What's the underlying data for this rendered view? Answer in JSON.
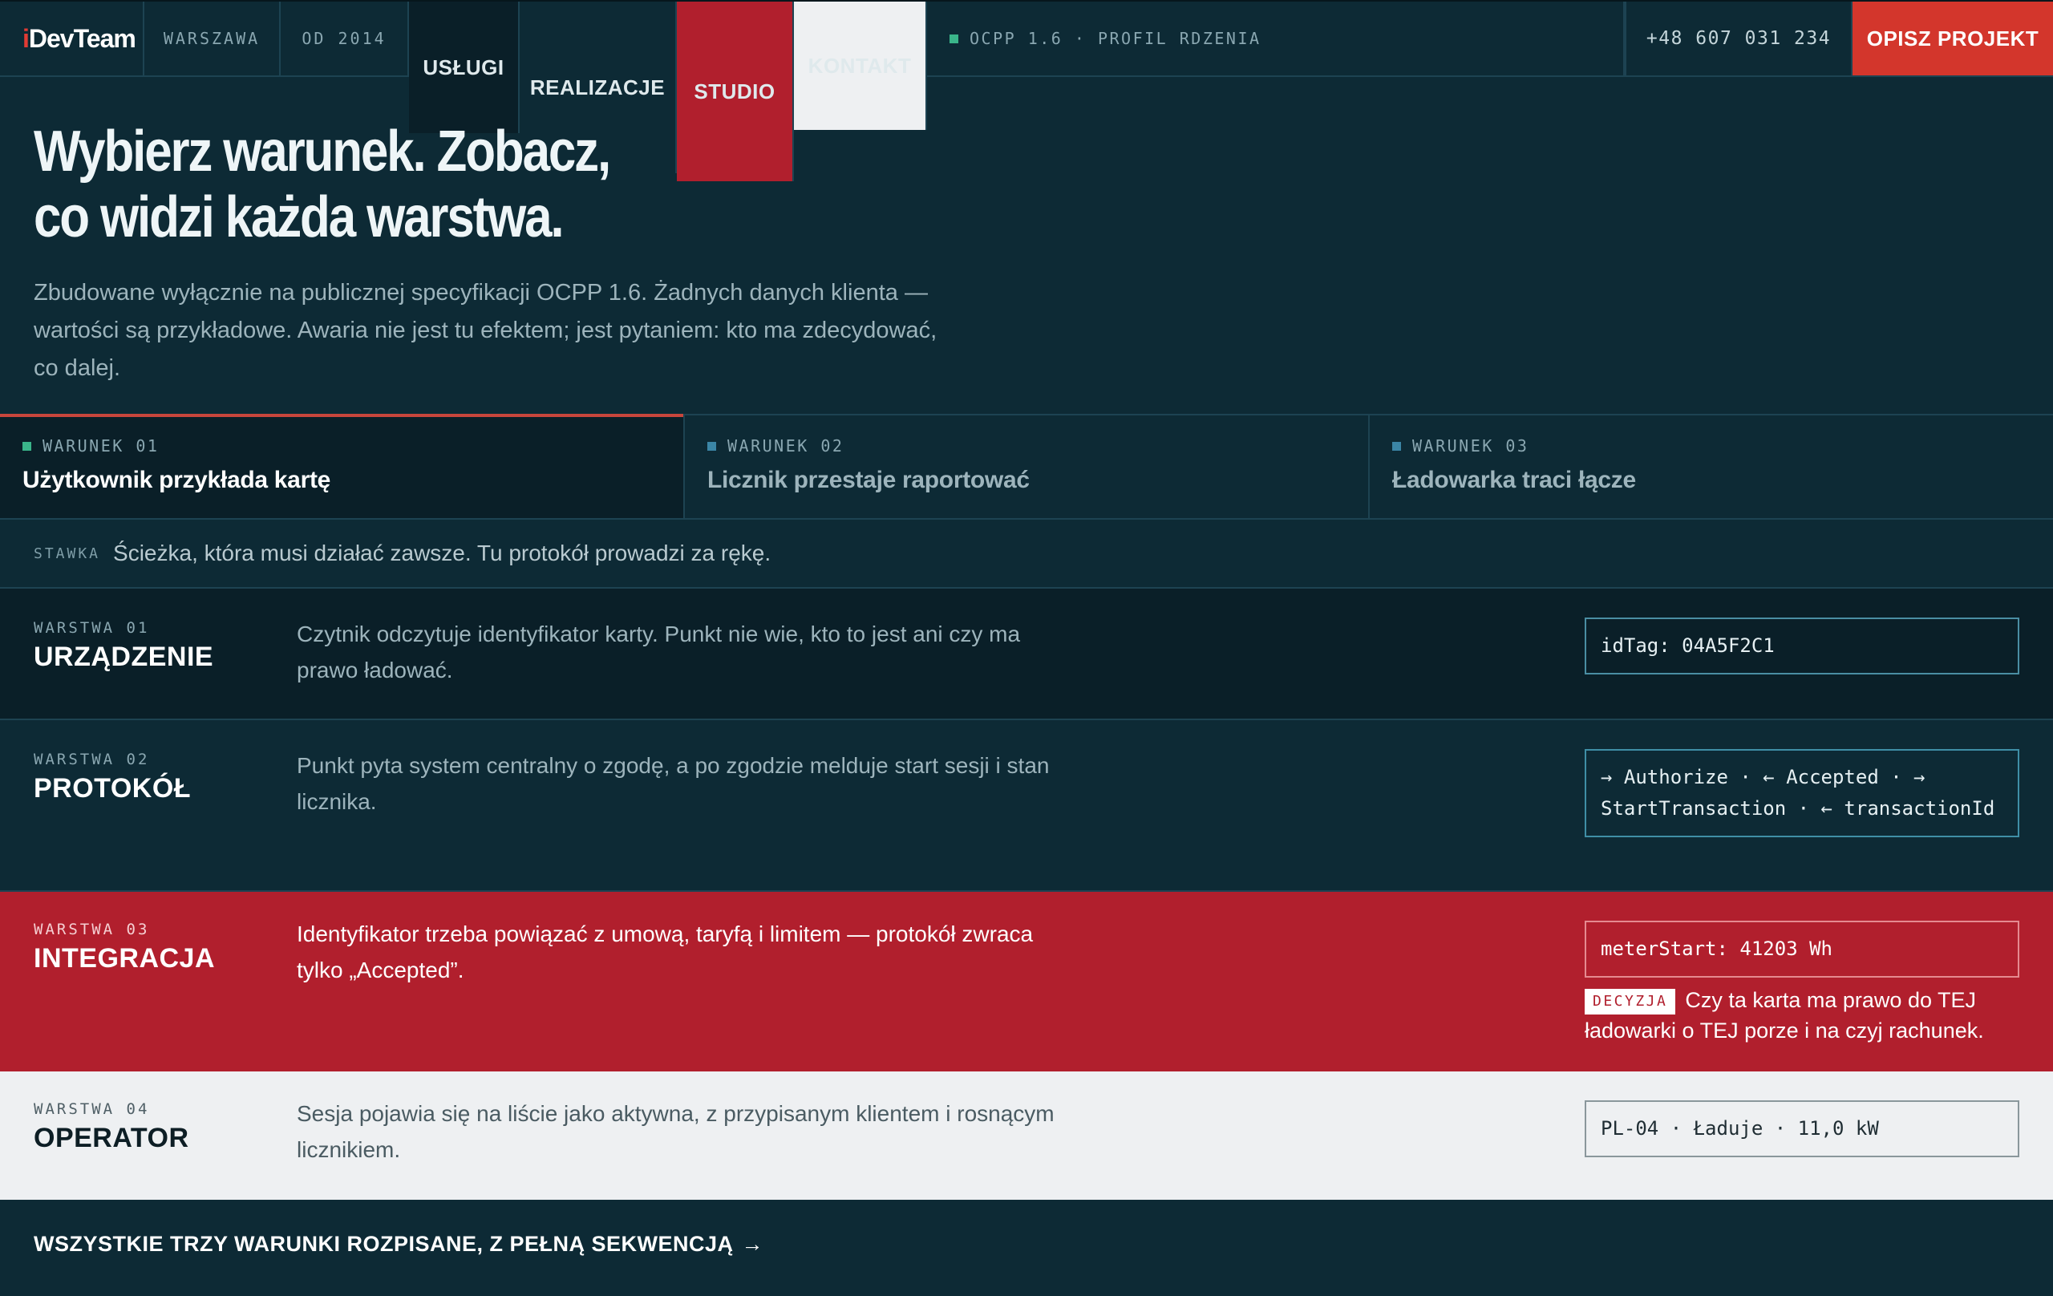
{
  "nav": {
    "logo_i": "i",
    "logo_rest": "DevTeam",
    "city": "WARSZAWA",
    "since": "OD 2014",
    "links": [
      "USŁUGI",
      "REALIZACJE",
      "STUDIO",
      "KONTAKT"
    ],
    "protocol": "OCPP 1.6 · PROFIL RDZENIA",
    "protocol_dot_color": "#3ab58a",
    "phone": "+48 607 031 234",
    "cta": "OPISZ PROJEKT",
    "cta_color": "#d3362c"
  },
  "hero": {
    "title_line1": "Wybierz warunek. Zobacz,",
    "title_line2": "co widzi każda warstwa.",
    "lead": "Zbudowane wyłącznie na publicznej specyfikacji OCPP 1.6. Żadnych danych klienta — wartości są przykładowe. Awaria nie jest tu efektem; jest pytaniem: kto ma zdecydować, co dalej."
  },
  "tabs": [
    {
      "label": "WARUNEK 01",
      "title": "Użytkownik przykłada kartę",
      "dot_color": "#3ab58a",
      "active": true
    },
    {
      "label": "WARUNEK 02",
      "title": "Licznik przestaje raportować",
      "dot_color": "#3b86a6",
      "active": false
    },
    {
      "label": "WARUNEK 03",
      "title": "Ładowarka traci łącze",
      "dot_color": "#3b86a6",
      "active": false
    }
  ],
  "stake": {
    "key": "STAWKA",
    "text": "Ścieżka, która musi działać zawsze. Tu protokół prowadzi za rękę."
  },
  "layers": [
    {
      "num": "WARSTWA 01",
      "name": "URZĄDZENIE",
      "desc": "Czytnik odczytuje identyfikator karty. Punkt nie wie, kto to jest ani czy ma prawo ładować.",
      "box": "idTag: 04A5F2C1"
    },
    {
      "num": "WARSTWA 02",
      "name": "PROTOKÓŁ",
      "desc": "Punkt pyta system centralny o zgodę, a po zgodzie melduje start sesji i stan licznika.",
      "box": "→ Authorize · ← Accepted · → StartTransaction · ← transactionId"
    },
    {
      "num": "WARSTWA 03",
      "name": "INTEGRACJA",
      "desc": "Identyfikator trzeba powiązać z umową, taryfą i limitem — protokół zwraca tylko „Accepted”.",
      "box": "meterStart: 41203 Wh",
      "decision_tag": "DECYZJA",
      "decision": "Czy ta karta ma prawo do TEJ ładowarki o TEJ porze i na czyj rachunek.",
      "bg_color": "#b11f2d"
    },
    {
      "num": "WARSTWA 04",
      "name": "OPERATOR",
      "desc": "Sesja pojawia się na liście jako aktywna, z przypisanym klientem i rosnącym licznikiem.",
      "box": "PL-04 · Ładuje · 11,0 kW"
    }
  ],
  "more": {
    "label": "WSZYSTKIE TRZY WARUNKI ROZPISANE, Z PEŁNĄ SEKWENCJĄ",
    "arrow": "→"
  }
}
